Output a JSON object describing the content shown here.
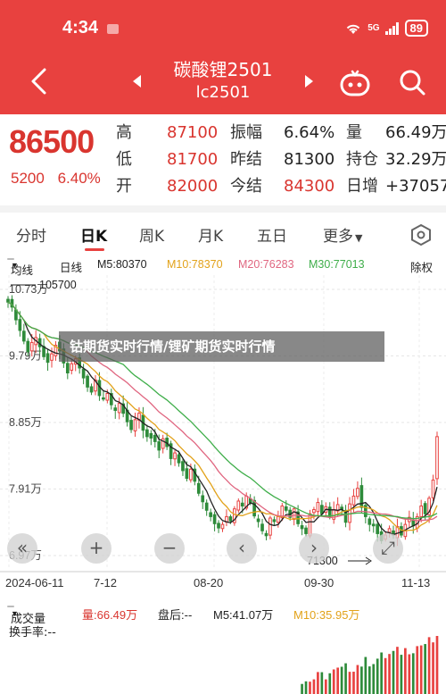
{
  "status": {
    "time": "4:34",
    "network": "5G",
    "battery": "89"
  },
  "header": {
    "title": "碳酸锂2501",
    "code": "lc2501"
  },
  "quote": {
    "price": "86500",
    "change": "5200",
    "change_pct": "6.40%",
    "rows": [
      {
        "l1": "高",
        "v1": "87100",
        "l2": "振幅",
        "v2": "6.64%",
        "l3": "量",
        "v3": "66.49万"
      },
      {
        "l1": "低",
        "v1": "81700",
        "l2": "昨结",
        "v2": "81300",
        "l3": "持仓",
        "v3": "32.29万"
      },
      {
        "l1": "开",
        "v1": "82000",
        "l2": "今结",
        "v2": "84300",
        "l3": "日增",
        "v3": "+37057"
      }
    ]
  },
  "tabs": [
    {
      "label": "分时"
    },
    {
      "label": "日K"
    },
    {
      "label": "周K"
    },
    {
      "label": "月K"
    },
    {
      "label": "五日"
    },
    {
      "label": "更多"
    }
  ],
  "indicators": {
    "type": "均线",
    "period": "日线",
    "m5": "M5:80370",
    "m10": "M10:78370",
    "m20": "M20:76283",
    "m30": "M30:77013",
    "adjust": "除权",
    "colors": {
      "m5": "#222222",
      "m10": "#e2a21a",
      "m20": "#e06680",
      "m30": "#3fae4a",
      "up": "#e8413f",
      "down": "#2e8b3a"
    }
  },
  "chart_labels": {
    "y_ticks": [
      "10.73万",
      "9.79万",
      "8.85万",
      "7.91万",
      "6.97万"
    ],
    "high_marker": "105700",
    "low_marker": "71300",
    "x_ticks": [
      "2024-06-11",
      "7-12",
      "08-20",
      "09-30",
      "11-13"
    ]
  },
  "overlay_text": "钴期货实时行情/锂矿期货实时行情",
  "volume": {
    "label": "成交量",
    "amount": "量:66.49万",
    "after": "盘后:--",
    "m5": "M5:41.07万",
    "m10": "M10:35.95万",
    "turnover": "换手率:--"
  },
  "chart_data": {
    "type": "candlestick",
    "y_ticks": [
      107300,
      97900,
      88500,
      79100,
      69700
    ],
    "x_ticks": [
      "2024-06-11",
      "7-12",
      "08-20",
      "09-30",
      "11-13"
    ],
    "annotations": [
      {
        "text": "105700"
      },
      {
        "text": "71300"
      }
    ],
    "series": [
      {
        "name": "M5",
        "value": 80370
      },
      {
        "name": "M10",
        "value": 78370
      },
      {
        "name": "M20",
        "value": 76283
      },
      {
        "name": "M30",
        "value": 77013
      }
    ],
    "close": [
      105500,
      104800,
      103000,
      101500,
      100000,
      98500,
      99800,
      100500,
      99200,
      97800,
      97000,
      98200,
      99400,
      98600,
      96900,
      95500,
      96800,
      97500,
      96200,
      94800,
      93500,
      92800,
      94500,
      92300,
      91800,
      92600,
      91000,
      90200,
      91200,
      89800,
      88600,
      87500,
      88900,
      89800,
      87400,
      86500,
      86300,
      85800,
      84600,
      86200,
      85100,
      83400,
      84200,
      82800,
      81700,
      80600,
      81900,
      80200,
      78500,
      77300,
      76100,
      75200,
      74200,
      73600,
      74100,
      75200,
      74600,
      76300,
      77400,
      76700,
      78100,
      77200,
      75300,
      74500,
      73200,
      72500,
      75000,
      74500,
      75200,
      76700,
      76100,
      75100,
      76300,
      74200,
      73500,
      72800,
      75600,
      76200,
      77200,
      75600,
      76600,
      75200,
      76200,
      76900,
      76200,
      74400,
      77000,
      78100,
      79200,
      76500,
      75200,
      74100,
      73900,
      72800,
      71800,
      72600,
      73500,
      72600,
      73800,
      72600,
      74100,
      75100,
      73900,
      75200,
      76700,
      75600,
      77800,
      80370,
      86500
    ],
    "volume_m10": "35.95万",
    "volume_m5": "41.07万"
  }
}
